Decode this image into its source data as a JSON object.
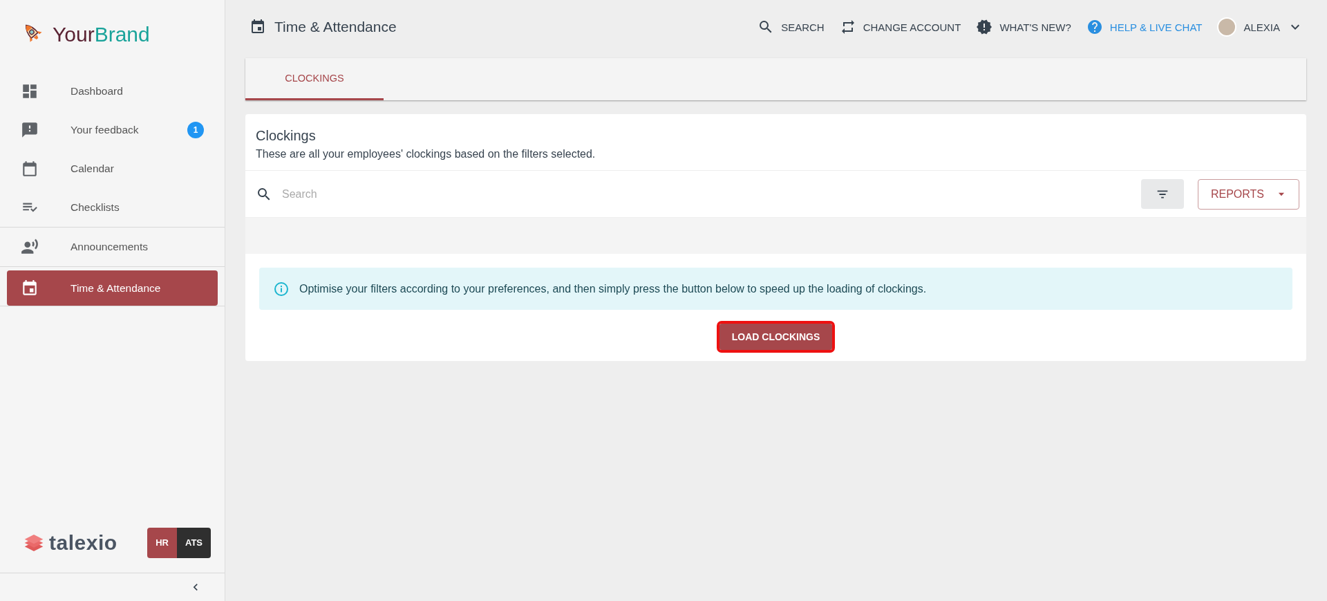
{
  "brand": {
    "parts": [
      "Your",
      "Brand"
    ]
  },
  "sidebar": {
    "groups": [
      [
        {
          "label": "Dashboard",
          "selected": false
        },
        {
          "label": "Your feedback",
          "selected": false,
          "badge": "1"
        },
        {
          "label": "Calendar",
          "selected": false
        },
        {
          "label": "Checklists",
          "selected": false
        }
      ],
      [
        {
          "label": "Announcements",
          "selected": false
        }
      ],
      [
        {
          "label": "Time & Attendance",
          "selected": true
        }
      ]
    ],
    "product_logo": "talexio",
    "switcher": [
      {
        "label": "HR",
        "selected": true
      },
      {
        "label": "ATS",
        "selected": false
      }
    ]
  },
  "header": {
    "title": "Time & Attendance",
    "actions": [
      {
        "kind": "search",
        "label": "SEARCH"
      },
      {
        "kind": "switch",
        "label": "CHANGE ACCOUNT"
      },
      {
        "kind": "news",
        "label": "WHAT'S NEW?"
      },
      {
        "kind": "help",
        "label": "HELP & LIVE CHAT"
      },
      {
        "kind": "user",
        "label": "ALEXIA"
      }
    ]
  },
  "tabs": [
    {
      "label": "CLOCKINGS",
      "selected": true
    }
  ],
  "card": {
    "title": "Clockings",
    "subtitle": "These are all your employees' clockings based on the filters selected.",
    "search": {
      "placeholder": "Search"
    },
    "reports_button": "REPORTS",
    "info": "Optimise your filters according to your preferences, and then simply press the button below to speed up the loading of clockings.",
    "load_button": {
      "label": "LOAD CLOCKINGS",
      "highlighted": true
    }
  }
}
